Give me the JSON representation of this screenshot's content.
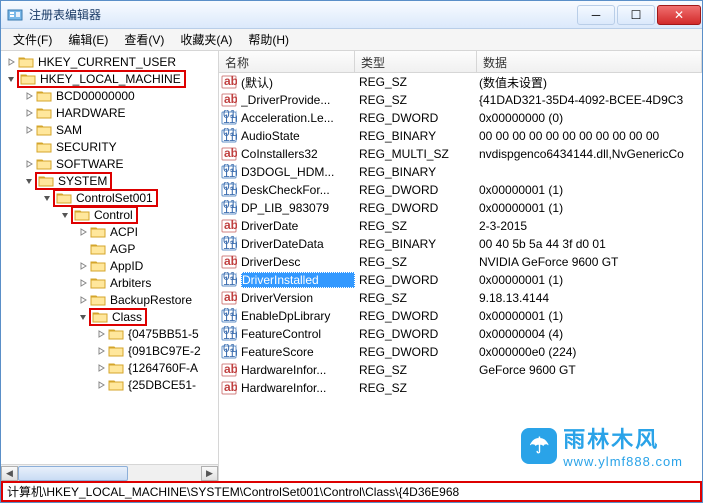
{
  "title": "注册表编辑器",
  "menu": [
    "文件(F)",
    "编辑(E)",
    "查看(V)",
    "收藏夹(A)",
    "帮助(H)"
  ],
  "tree": [
    {
      "indent": 0,
      "caret": "r",
      "label": "HKEY_CURRENT_USER"
    },
    {
      "indent": 0,
      "caret": "d",
      "label": "HKEY_LOCAL_MACHINE",
      "hl": 1
    },
    {
      "indent": 1,
      "caret": "r",
      "label": "BCD00000000"
    },
    {
      "indent": 1,
      "caret": "r",
      "label": "HARDWARE"
    },
    {
      "indent": 1,
      "caret": "r",
      "label": "SAM"
    },
    {
      "indent": 1,
      "caret": "",
      "label": "SECURITY"
    },
    {
      "indent": 1,
      "caret": "r",
      "label": "SOFTWARE"
    },
    {
      "indent": 1,
      "caret": "d",
      "label": "SYSTEM",
      "hl": 1
    },
    {
      "indent": 2,
      "caret": "d",
      "label": "ControlSet001",
      "hl": 1
    },
    {
      "indent": 3,
      "caret": "d",
      "label": "Control",
      "hl": 1
    },
    {
      "indent": 4,
      "caret": "r",
      "label": "ACPI"
    },
    {
      "indent": 4,
      "caret": "",
      "label": "AGP"
    },
    {
      "indent": 4,
      "caret": "r",
      "label": "AppID"
    },
    {
      "indent": 4,
      "caret": "r",
      "label": "Arbiters"
    },
    {
      "indent": 4,
      "caret": "r",
      "label": "BackupRestore"
    },
    {
      "indent": 4,
      "caret": "d",
      "label": "Class",
      "hl": 1
    },
    {
      "indent": 5,
      "caret": "r",
      "label": "{0475BB51-5"
    },
    {
      "indent": 5,
      "caret": "r",
      "label": "{091BC97E-2"
    },
    {
      "indent": 5,
      "caret": "r",
      "label": "{1264760F-A"
    },
    {
      "indent": 5,
      "caret": "r",
      "label": "{25DBCE51-"
    }
  ],
  "cols": {
    "c1": "名称",
    "c2": "类型",
    "c3": "数据",
    "w1": 136,
    "w2": 122
  },
  "rows": [
    {
      "t": "sz",
      "n": "(默认)",
      "y": "REG_SZ",
      "d": "(数值未设置)"
    },
    {
      "t": "sz",
      "n": "_DriverProvide...",
      "y": "REG_SZ",
      "d": "{41DAD321-35D4-4092-BCEE-4D9C3"
    },
    {
      "t": "bin",
      "n": "Acceleration.Le...",
      "y": "REG_DWORD",
      "d": "0x00000000 (0)"
    },
    {
      "t": "bin",
      "n": "AudioState",
      "y": "REG_BINARY",
      "d": "00 00 00 00 00 00 00 00 00 00 00"
    },
    {
      "t": "sz",
      "n": "CoInstallers32",
      "y": "REG_MULTI_SZ",
      "d": "nvdispgenco6434144.dll,NvGenericCo"
    },
    {
      "t": "bin",
      "n": "D3DOGL_HDM...",
      "y": "REG_BINARY",
      "d": ""
    },
    {
      "t": "bin",
      "n": "DeskCheckFor...",
      "y": "REG_DWORD",
      "d": "0x00000001 (1)"
    },
    {
      "t": "bin",
      "n": "DP_LIB_983079",
      "y": "REG_DWORD",
      "d": "0x00000001 (1)"
    },
    {
      "t": "sz",
      "n": "DriverDate",
      "y": "REG_SZ",
      "d": "2-3-2015"
    },
    {
      "t": "bin",
      "n": "DriverDateData",
      "y": "REG_BINARY",
      "d": "00 40 5b 5a 44 3f d0 01"
    },
    {
      "t": "sz",
      "n": "DriverDesc",
      "y": "REG_SZ",
      "d": "NVIDIA GeForce 9600 GT"
    },
    {
      "t": "bin",
      "n": "DriverInstalled",
      "y": "REG_DWORD",
      "d": "0x00000001 (1)",
      "sel": 1
    },
    {
      "t": "sz",
      "n": "DriverVersion",
      "y": "REG_SZ",
      "d": "9.18.13.4144"
    },
    {
      "t": "bin",
      "n": "EnableDpLibrary",
      "y": "REG_DWORD",
      "d": "0x00000001 (1)"
    },
    {
      "t": "bin",
      "n": "FeatureControl",
      "y": "REG_DWORD",
      "d": "0x00000004 (4)"
    },
    {
      "t": "bin",
      "n": "FeatureScore",
      "y": "REG_DWORD",
      "d": "0x000000e0 (224)"
    },
    {
      "t": "sz",
      "n": "HardwareInfor...",
      "y": "REG_SZ",
      "d": "GeForce 9600 GT"
    },
    {
      "t": "sz",
      "n": "HardwareInfor...",
      "y": "REG_SZ",
      "d": ""
    }
  ],
  "status": "计算机\\HKEY_LOCAL_MACHINE\\SYSTEM\\ControlSet001\\Control\\Class\\{4D36E968",
  "wm": {
    "t1": "雨林木风",
    "t2": "www.ylmf888.com"
  }
}
